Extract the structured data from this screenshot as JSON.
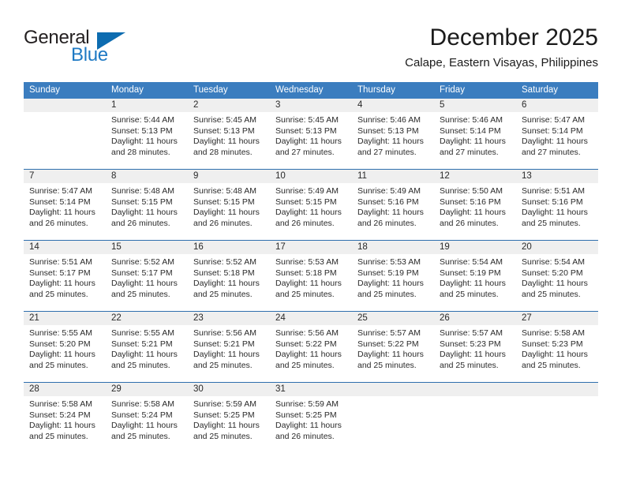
{
  "brand": {
    "name_part1": "General",
    "name_part2": "Blue"
  },
  "header": {
    "title": "December 2025",
    "subtitle": "Calape, Eastern Visayas, Philippines"
  },
  "colors": {
    "header_blue": "#3b7dbf",
    "row_divider_blue": "#2f6fad",
    "day_strip_gray": "#efefef",
    "logo_blue": "#1f7ac4",
    "text": "#2a2a2a"
  },
  "weekdays": [
    "Sunday",
    "Monday",
    "Tuesday",
    "Wednesday",
    "Thursday",
    "Friday",
    "Saturday"
  ],
  "weeks": [
    [
      {
        "day": "",
        "sunrise": "",
        "sunset": "",
        "daylight_line1": "",
        "daylight_line2": ""
      },
      {
        "day": "1",
        "sunrise": "Sunrise: 5:44 AM",
        "sunset": "Sunset: 5:13 PM",
        "daylight_line1": "Daylight: 11 hours",
        "daylight_line2": "and 28 minutes."
      },
      {
        "day": "2",
        "sunrise": "Sunrise: 5:45 AM",
        "sunset": "Sunset: 5:13 PM",
        "daylight_line1": "Daylight: 11 hours",
        "daylight_line2": "and 28 minutes."
      },
      {
        "day": "3",
        "sunrise": "Sunrise: 5:45 AM",
        "sunset": "Sunset: 5:13 PM",
        "daylight_line1": "Daylight: 11 hours",
        "daylight_line2": "and 27 minutes."
      },
      {
        "day": "4",
        "sunrise": "Sunrise: 5:46 AM",
        "sunset": "Sunset: 5:13 PM",
        "daylight_line1": "Daylight: 11 hours",
        "daylight_line2": "and 27 minutes."
      },
      {
        "day": "5",
        "sunrise": "Sunrise: 5:46 AM",
        "sunset": "Sunset: 5:14 PM",
        "daylight_line1": "Daylight: 11 hours",
        "daylight_line2": "and 27 minutes."
      },
      {
        "day": "6",
        "sunrise": "Sunrise: 5:47 AM",
        "sunset": "Sunset: 5:14 PM",
        "daylight_line1": "Daylight: 11 hours",
        "daylight_line2": "and 27 minutes."
      }
    ],
    [
      {
        "day": "7",
        "sunrise": "Sunrise: 5:47 AM",
        "sunset": "Sunset: 5:14 PM",
        "daylight_line1": "Daylight: 11 hours",
        "daylight_line2": "and 26 minutes."
      },
      {
        "day": "8",
        "sunrise": "Sunrise: 5:48 AM",
        "sunset": "Sunset: 5:15 PM",
        "daylight_line1": "Daylight: 11 hours",
        "daylight_line2": "and 26 minutes."
      },
      {
        "day": "9",
        "sunrise": "Sunrise: 5:48 AM",
        "sunset": "Sunset: 5:15 PM",
        "daylight_line1": "Daylight: 11 hours",
        "daylight_line2": "and 26 minutes."
      },
      {
        "day": "10",
        "sunrise": "Sunrise: 5:49 AM",
        "sunset": "Sunset: 5:15 PM",
        "daylight_line1": "Daylight: 11 hours",
        "daylight_line2": "and 26 minutes."
      },
      {
        "day": "11",
        "sunrise": "Sunrise: 5:49 AM",
        "sunset": "Sunset: 5:16 PM",
        "daylight_line1": "Daylight: 11 hours",
        "daylight_line2": "and 26 minutes."
      },
      {
        "day": "12",
        "sunrise": "Sunrise: 5:50 AM",
        "sunset": "Sunset: 5:16 PM",
        "daylight_line1": "Daylight: 11 hours",
        "daylight_line2": "and 26 minutes."
      },
      {
        "day": "13",
        "sunrise": "Sunrise: 5:51 AM",
        "sunset": "Sunset: 5:16 PM",
        "daylight_line1": "Daylight: 11 hours",
        "daylight_line2": "and 25 minutes."
      }
    ],
    [
      {
        "day": "14",
        "sunrise": "Sunrise: 5:51 AM",
        "sunset": "Sunset: 5:17 PM",
        "daylight_line1": "Daylight: 11 hours",
        "daylight_line2": "and 25 minutes."
      },
      {
        "day": "15",
        "sunrise": "Sunrise: 5:52 AM",
        "sunset": "Sunset: 5:17 PM",
        "daylight_line1": "Daylight: 11 hours",
        "daylight_line2": "and 25 minutes."
      },
      {
        "day": "16",
        "sunrise": "Sunrise: 5:52 AM",
        "sunset": "Sunset: 5:18 PM",
        "daylight_line1": "Daylight: 11 hours",
        "daylight_line2": "and 25 minutes."
      },
      {
        "day": "17",
        "sunrise": "Sunrise: 5:53 AM",
        "sunset": "Sunset: 5:18 PM",
        "daylight_line1": "Daylight: 11 hours",
        "daylight_line2": "and 25 minutes."
      },
      {
        "day": "18",
        "sunrise": "Sunrise: 5:53 AM",
        "sunset": "Sunset: 5:19 PM",
        "daylight_line1": "Daylight: 11 hours",
        "daylight_line2": "and 25 minutes."
      },
      {
        "day": "19",
        "sunrise": "Sunrise: 5:54 AM",
        "sunset": "Sunset: 5:19 PM",
        "daylight_line1": "Daylight: 11 hours",
        "daylight_line2": "and 25 minutes."
      },
      {
        "day": "20",
        "sunrise": "Sunrise: 5:54 AM",
        "sunset": "Sunset: 5:20 PM",
        "daylight_line1": "Daylight: 11 hours",
        "daylight_line2": "and 25 minutes."
      }
    ],
    [
      {
        "day": "21",
        "sunrise": "Sunrise: 5:55 AM",
        "sunset": "Sunset: 5:20 PM",
        "daylight_line1": "Daylight: 11 hours",
        "daylight_line2": "and 25 minutes."
      },
      {
        "day": "22",
        "sunrise": "Sunrise: 5:55 AM",
        "sunset": "Sunset: 5:21 PM",
        "daylight_line1": "Daylight: 11 hours",
        "daylight_line2": "and 25 minutes."
      },
      {
        "day": "23",
        "sunrise": "Sunrise: 5:56 AM",
        "sunset": "Sunset: 5:21 PM",
        "daylight_line1": "Daylight: 11 hours",
        "daylight_line2": "and 25 minutes."
      },
      {
        "day": "24",
        "sunrise": "Sunrise: 5:56 AM",
        "sunset": "Sunset: 5:22 PM",
        "daylight_line1": "Daylight: 11 hours",
        "daylight_line2": "and 25 minutes."
      },
      {
        "day": "25",
        "sunrise": "Sunrise: 5:57 AM",
        "sunset": "Sunset: 5:22 PM",
        "daylight_line1": "Daylight: 11 hours",
        "daylight_line2": "and 25 minutes."
      },
      {
        "day": "26",
        "sunrise": "Sunrise: 5:57 AM",
        "sunset": "Sunset: 5:23 PM",
        "daylight_line1": "Daylight: 11 hours",
        "daylight_line2": "and 25 minutes."
      },
      {
        "day": "27",
        "sunrise": "Sunrise: 5:58 AM",
        "sunset": "Sunset: 5:23 PM",
        "daylight_line1": "Daylight: 11 hours",
        "daylight_line2": "and 25 minutes."
      }
    ],
    [
      {
        "day": "28",
        "sunrise": "Sunrise: 5:58 AM",
        "sunset": "Sunset: 5:24 PM",
        "daylight_line1": "Daylight: 11 hours",
        "daylight_line2": "and 25 minutes."
      },
      {
        "day": "29",
        "sunrise": "Sunrise: 5:58 AM",
        "sunset": "Sunset: 5:24 PM",
        "daylight_line1": "Daylight: 11 hours",
        "daylight_line2": "and 25 minutes."
      },
      {
        "day": "30",
        "sunrise": "Sunrise: 5:59 AM",
        "sunset": "Sunset: 5:25 PM",
        "daylight_line1": "Daylight: 11 hours",
        "daylight_line2": "and 25 minutes."
      },
      {
        "day": "31",
        "sunrise": "Sunrise: 5:59 AM",
        "sunset": "Sunset: 5:25 PM",
        "daylight_line1": "Daylight: 11 hours",
        "daylight_line2": "and 26 minutes."
      },
      {
        "day": "",
        "sunrise": "",
        "sunset": "",
        "daylight_line1": "",
        "daylight_line2": ""
      },
      {
        "day": "",
        "sunrise": "",
        "sunset": "",
        "daylight_line1": "",
        "daylight_line2": ""
      },
      {
        "day": "",
        "sunrise": "",
        "sunset": "",
        "daylight_line1": "",
        "daylight_line2": ""
      }
    ]
  ]
}
